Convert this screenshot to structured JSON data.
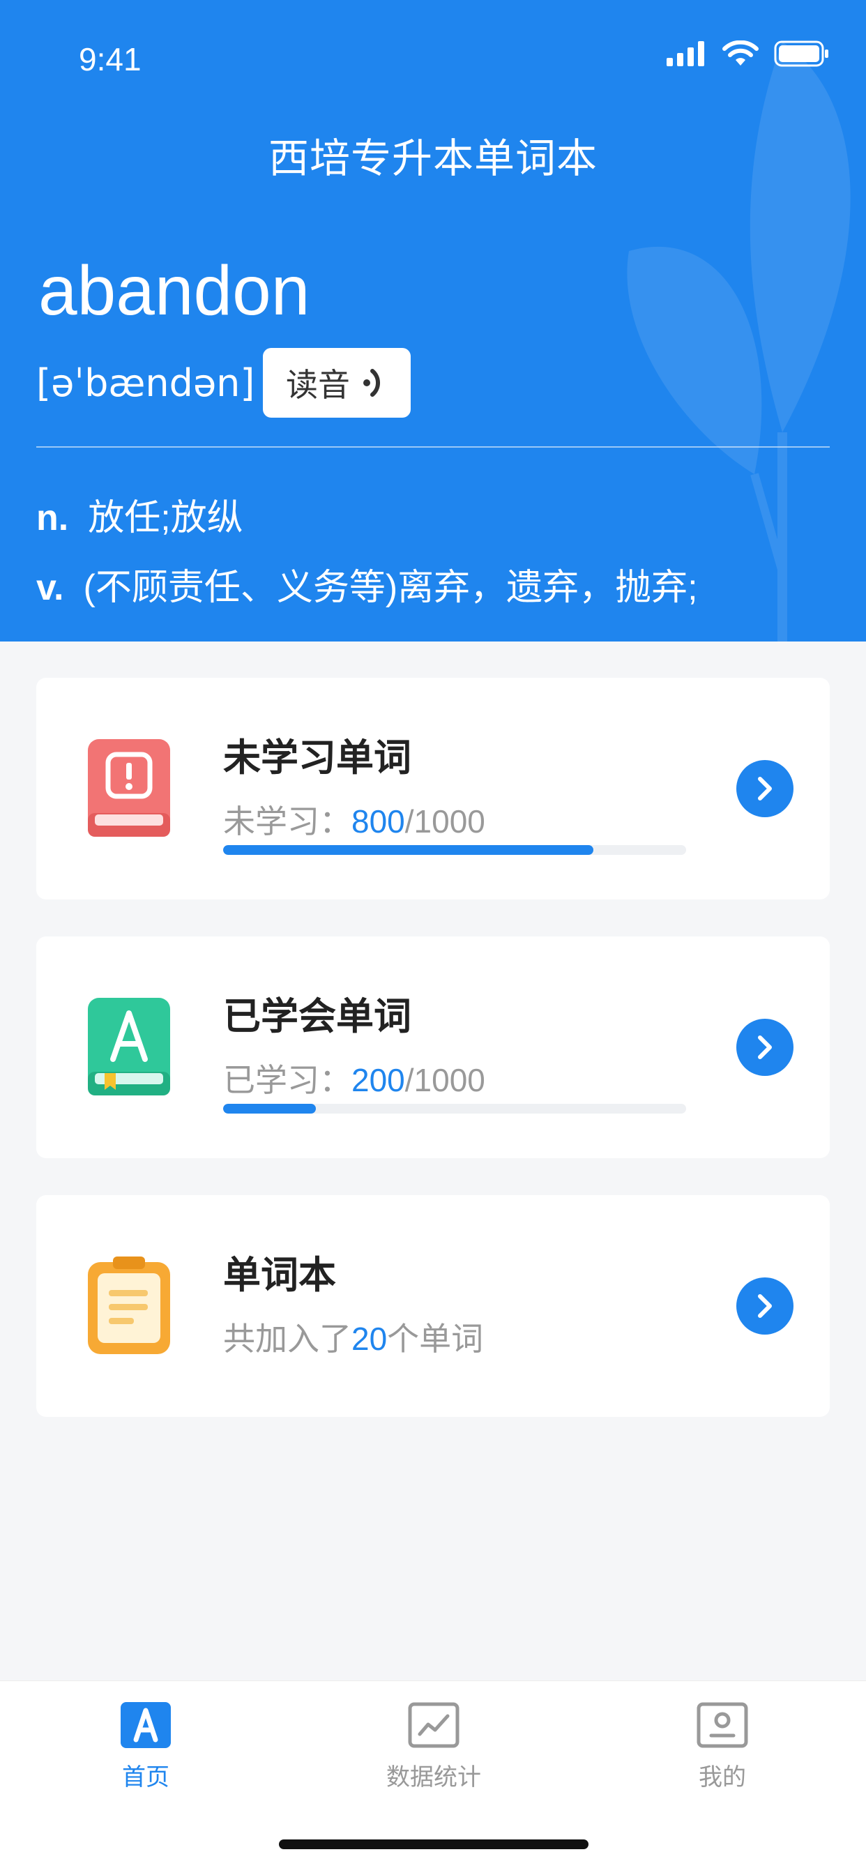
{
  "status_bar": {
    "time": "9:41"
  },
  "header": {
    "app_title": "西培专升本单词本",
    "word": "abandon",
    "phonetic": "[əˈbændən]",
    "pronounce_label": "读音",
    "definitions": [
      {
        "pos": "n.",
        "text": "放任;放纵"
      },
      {
        "pos": "v.",
        "text": "(不顾责任、义务等)离弃，遗弃，抛弃;"
      }
    ]
  },
  "cards": [
    {
      "title": "未学习单词",
      "label": "未学习：",
      "count": "800",
      "total": "/1000",
      "progress": 0.8
    },
    {
      "title": "已学会单词",
      "label": "已学习：",
      "count": "200",
      "total": "/1000",
      "progress": 0.2
    },
    {
      "title": "单词本",
      "prefix": "共加入了",
      "count": "20",
      "suffix": "个单词"
    }
  ],
  "tabbar": [
    {
      "label": "首页",
      "active": true
    },
    {
      "label": "数据统计",
      "active": false
    },
    {
      "label": "我的",
      "active": false
    }
  ],
  "colors": {
    "accent": "#1f85ee",
    "red_icon": "#f27474",
    "green_icon": "#2fc89a",
    "orange_icon": "#f7a934"
  }
}
